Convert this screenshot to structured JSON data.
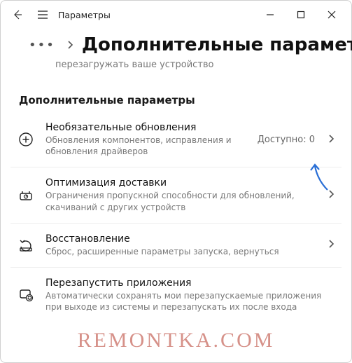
{
  "titlebar": {
    "app_title": "Параметры"
  },
  "header": {
    "page_title": "Дополнительные параметры",
    "subtitle": "перезагружать ваше устройство"
  },
  "section": {
    "heading": "Дополнительные параметры"
  },
  "items": [
    {
      "title": "Необязательные обновления",
      "desc": "Обновления компонентов, исправления и обновления драйверов",
      "status": "Доступно: 0"
    },
    {
      "title": "Оптимизация доставки",
      "desc": "Ограничения пропускной способности для обновлений, скачиваний с других устройств",
      "status": ""
    },
    {
      "title": "Восстановление",
      "desc": "Сброс, расширенные параметры запуска, вернуться",
      "status": ""
    },
    {
      "title": "Перезапустить приложения",
      "desc": "Автоматически сохранять мои перезапускаемые приложения при выходе из системы и перезапускать их после входа",
      "status": ""
    }
  ],
  "watermark": "REMONTKA.COM"
}
